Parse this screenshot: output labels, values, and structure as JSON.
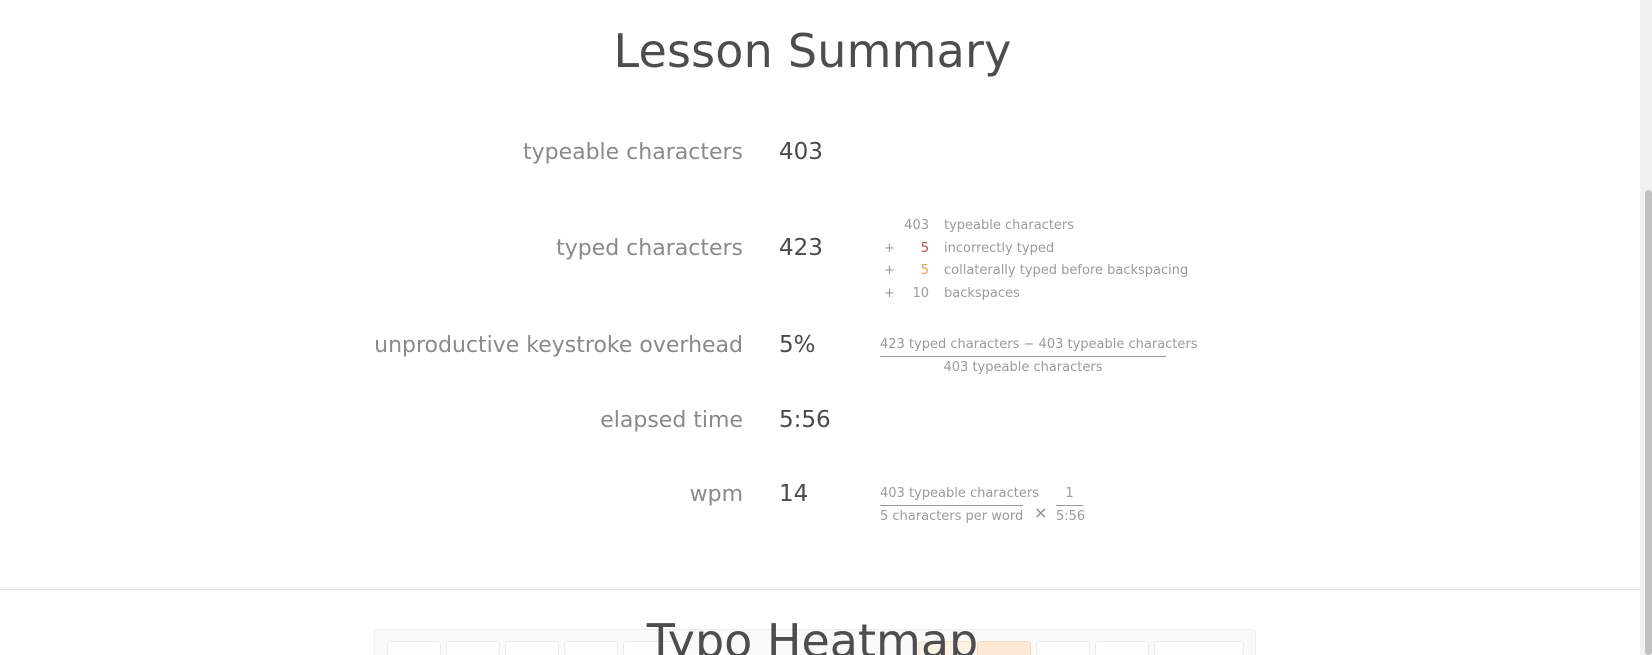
{
  "summary": {
    "title": "Lesson Summary",
    "rows": [
      {
        "label": "typeable characters",
        "value": "403"
      },
      {
        "label": "typed characters",
        "value": "423"
      },
      {
        "label": "unproductive keystroke overhead",
        "value": "5%"
      },
      {
        "label": "elapsed time",
        "value": "5:56"
      },
      {
        "label": "wpm",
        "value": "14"
      }
    ],
    "breakdown": [
      {
        "op": "",
        "num": "403",
        "text": "typeable characters"
      },
      {
        "op": "+",
        "num": "5",
        "text": "incorrectly typed"
      },
      {
        "op": "+",
        "num": "5",
        "text": "collaterally typed before backspacing"
      },
      {
        "op": "+",
        "num": "10",
        "text": "backspaces"
      }
    ],
    "overhead_formula": {
      "numerator": "423 typed characters − 403 typeable characters",
      "denominator": "403 typeable characters"
    },
    "wpm_formula": {
      "numerator": "403 typeable characters",
      "denominator": "5 characters per word",
      "times": "×",
      "numerator2": "1",
      "denominator2": "5:56"
    },
    "colors": {
      "incorrect": "#b94a48",
      "collateral": "#e8a04c"
    }
  },
  "heatmap": {
    "title": "Typo Heatmap"
  }
}
